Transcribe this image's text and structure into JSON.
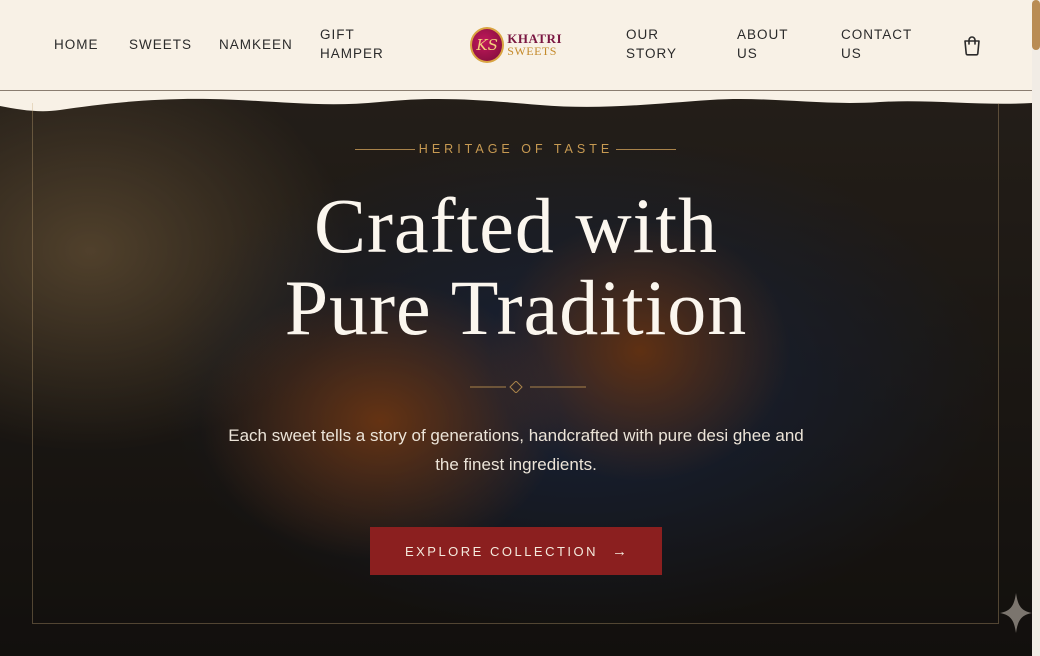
{
  "nav": {
    "home": "HOME",
    "sweets": "SWEETS",
    "namkeen": "NAMKEEN",
    "gift_hamper_1": "GIFT",
    "gift_hamper_2": "HAMPER",
    "our_story_1": "OUR",
    "our_story_2": "STORY",
    "about_1": "ABOUT",
    "about_2": "US",
    "contact_1": "CONTACT",
    "contact_2": "US"
  },
  "logo": {
    "monogram": "KS",
    "line1": "KHATRI",
    "line2": "SWEETS"
  },
  "hero": {
    "eyebrow": "HERITAGE OF TASTE",
    "title_line1": "Crafted with",
    "title_line2": "Pure Tradition",
    "subtitle": "Each sweet tells a story of generations, handcrafted with pure desi ghee and the finest ingredients.",
    "cta_label": "EXPLORE COLLECTION",
    "cta_arrow": "→"
  },
  "icons": {
    "cart": "shopping-bag-icon",
    "sparkle": "sparkle-icon",
    "arrow": "arrow-right-icon"
  },
  "colors": {
    "header_bg": "#f8f1e6",
    "accent_gold": "#c79a52",
    "cta_bg": "#8b1f1f",
    "brand_maroon": "#7a1742"
  }
}
